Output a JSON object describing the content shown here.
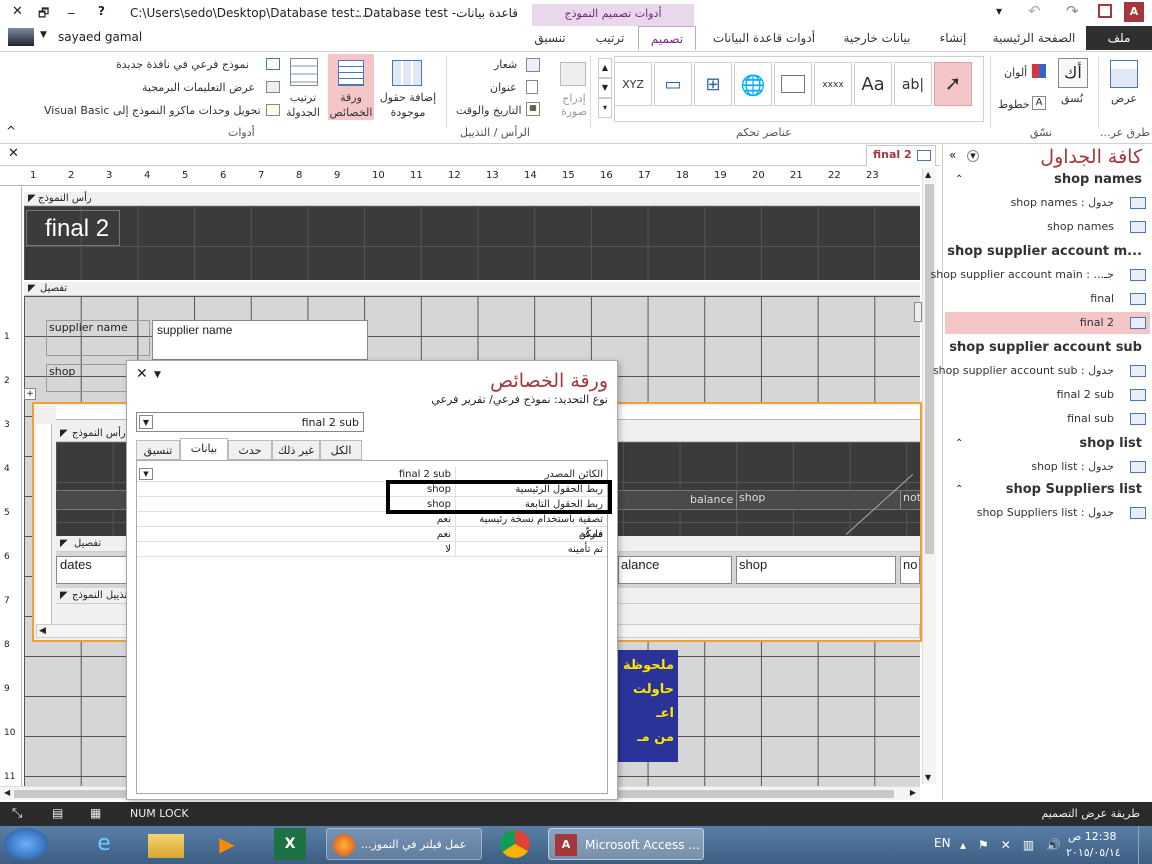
{
  "title": {
    "path": "C:\\Users\\sedo\\Desktop\\Database test....",
    "db": "قاعدة بيانات- Database test :",
    "min": "_",
    "max": "🗗",
    "close": "✕",
    "help": "?"
  },
  "ribbon": {
    "tools_header": "أدوات تصميم النموذج",
    "user": "sayaed gamal",
    "tabs": {
      "file": "ملف",
      "home": "الصفحة الرئيسية",
      "create": "إنشاء",
      "external": "بيانات خارجية",
      "dbtools": "أدوات قاعدة البيانات",
      "design": "تصميم",
      "arrange": "ترتيب",
      "format": "تنسيق"
    },
    "views": {
      "view": "عرض",
      "group": "طرق عر..."
    },
    "themes": {
      "colors": "ألوان",
      "fonts": "خطوط",
      "themes": "نُسق",
      "group": "نسّق"
    },
    "controls": {
      "group": "عناصر تحكم",
      "xyz": "XYZ",
      "ab": "ab|",
      "aa": "Aa",
      "xxxx": "xxxx"
    },
    "header_footer": {
      "logo": "شعار",
      "title": "عنوان",
      "datetime": "التاريخ والوقت",
      "group": "الرأس / التذييل",
      "insert_image": "إدراج صورة"
    },
    "tools": {
      "add_fields": "إضافة حقول موجودة",
      "property_sheet": "ورقة الخصائص",
      "tab_order": "ترتيب الجدولة",
      "subform_new_window": "نموذج فرعي في نافذة جديدة",
      "view_code": "عرض التعليمات البرمجية",
      "convert_macros": "تحويل وحدات ماكرو النموذج إلى Visual Basic",
      "group": "أدوات"
    }
  },
  "nav": {
    "title": "كافة الجداول",
    "groups": [
      {
        "name": "shop names",
        "items": [
          "جدول : shop names",
          "shop names"
        ]
      },
      {
        "name": "shop supplier account m...",
        "items": [
          "جـ... : shop supplier account main",
          "final",
          "final 2"
        ]
      },
      {
        "name": "shop supplier account sub",
        "items": [
          "جدول : shop supplier account sub",
          "final 2 sub",
          "final sub"
        ]
      },
      {
        "name": "shop list",
        "items": [
          "جدول : shop list"
        ]
      },
      {
        "name": "shop Suppliers list",
        "items": [
          "جدول : shop Suppliers list"
        ]
      }
    ]
  },
  "doc": {
    "tab": "final 2",
    "ruler": [
      "1",
      "2",
      "3",
      "4",
      "5",
      "6",
      "7",
      "8",
      "9",
      "10",
      "11",
      "12",
      "13",
      "14",
      "15",
      "16",
      "17",
      "18",
      "19",
      "20",
      "21",
      "22",
      "23"
    ],
    "header_bar": "رأس النموذج",
    "detail_bar": "تفصيل",
    "form_title": "final 2",
    "supplier_label": "supplier name",
    "supplier_box": "supplier name",
    "shop_label": "shop",
    "sub_header_bar": "رأس النموذج",
    "sub_detail_bar": "تفصيل",
    "sub_footer_bar": "تذييل النموذج",
    "sub_dates": "dates",
    "sub_balance_hdr": "balance",
    "sub_shop_hdr": "shop",
    "sub_not_hdr": "not",
    "sub_balance": "alance",
    "sub_shop": "shop",
    "sub_not": "no",
    "note": [
      "ملحوظة",
      "حاولت اعـ",
      "من مـ"
    ]
  },
  "props": {
    "title": "ورقة الخصائص",
    "sel_label": "نوع التحديد:",
    "sel_type": "نموذج فرعي/ تقرير فرعي",
    "combo": "final 2 sub",
    "tabs": {
      "format": "تنسيق",
      "data": "بيانات",
      "event": "حدث",
      "other": "غير ذلك",
      "all": "الكل"
    },
    "rows": [
      {
        "k": "الكائن المصدر",
        "v": "final 2 sub"
      },
      {
        "k": "ربط الحقول الرئيسية",
        "v": "shop"
      },
      {
        "k": "ربط الحقول التابعة",
        "v": "shop"
      },
      {
        "k": "تصفية باستخدام نسخة رئيسية فارغة",
        "v": "نعم"
      },
      {
        "k": "ممكّن",
        "v": "نعم"
      },
      {
        "k": "تم تأمينه",
        "v": "لا"
      }
    ]
  },
  "status": {
    "mode": "طريقة عرض التصميم",
    "numlock": "NUM LOCK"
  },
  "taskbar": {
    "firefox": "عمل فيلتر في النموز...",
    "access": "Microsoft Access ...",
    "lang": "EN",
    "time": "12:38 ص",
    "date": "٢٠١٥/٠٥/١٤"
  },
  "colors": {
    "accent": "#a4373a",
    "select": "#f5c6c8",
    "form_dark": "#3b3b3b",
    "note": "#2a3399"
  }
}
